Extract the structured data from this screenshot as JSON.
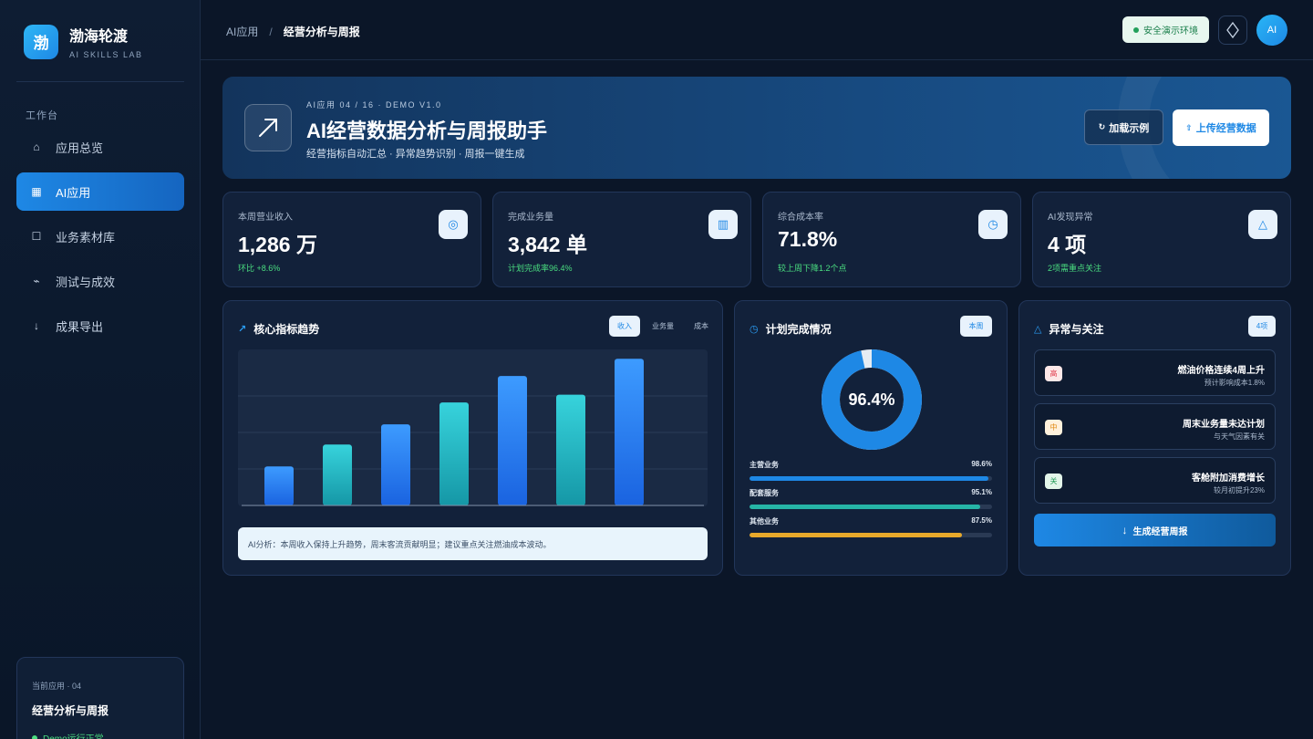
{
  "brand": {
    "logo_char": "渤",
    "name": "渤海轮渡",
    "subtitle": "AI SKILLS LAB"
  },
  "sidebar": {
    "section_label": "工作台",
    "items": [
      {
        "label": "应用总览",
        "icon": "home-icon",
        "glyph": "⌂",
        "active": false
      },
      {
        "label": "AI应用",
        "icon": "grid-icon",
        "glyph": "▦",
        "active": true
      },
      {
        "label": "业务素材库",
        "icon": "folder-icon",
        "glyph": "☐",
        "active": false
      },
      {
        "label": "测试与成效",
        "icon": "pulse-icon",
        "glyph": "⌁",
        "active": false
      },
      {
        "label": "成果导出",
        "icon": "download-icon",
        "glyph": "↓",
        "active": false
      }
    ],
    "current": {
      "label": "当前应用 · 04",
      "name": "经营分析与周报",
      "status": "Demo运行正常"
    }
  },
  "header": {
    "breadcrumb": [
      "AI应用",
      "经营分析与周报"
    ],
    "breadcrumb_sep": "/",
    "env_badge": "安全演示环境",
    "avatar_initials": "AI"
  },
  "hero": {
    "kicker": "AI应用 04 / 16 · DEMO V1.0",
    "title": "AI经营数据分析与周报助手",
    "subtitle": "经营指标自动汇总 · 异常趋势识别 · 周报一键生成",
    "load_button": "加载示例",
    "upload_button": "上传经营数据"
  },
  "kpis": [
    {
      "label": "本周营业收入",
      "value": "1,286 万",
      "note": "环比 +8.6%",
      "icon": "target-icon",
      "glyph": "◎"
    },
    {
      "label": "完成业务量",
      "value": "3,842 单",
      "note": "计划完成率96.4%",
      "icon": "barcode-icon",
      "glyph": "▥"
    },
    {
      "label": "综合成本率",
      "value": "71.8%",
      "note": "较上周下降1.2个点",
      "icon": "clock-icon",
      "glyph": "◷"
    },
    {
      "label": "AI发现异常",
      "value": "4 项",
      "note": "2项需重点关注",
      "icon": "warning-icon",
      "glyph": "△"
    }
  ],
  "trend": {
    "title": "核心指标趋势",
    "tabs": [
      "收入",
      "业务量",
      "成本"
    ],
    "active_tab": 0,
    "analysis": "AI分析：本周收入保持上升趋势，周末客流贡献明显；建议重点关注燃油成本波动。"
  },
  "chart_data": {
    "type": "bar",
    "values": [
      25,
      39,
      52,
      66,
      83,
      71,
      94
    ],
    "ylim": [
      0,
      100
    ],
    "colors": [
      "#2f7ff0",
      "#22b8c2",
      "#2f7ff0",
      "#22b8c2",
      "#2f7ff0",
      "#22b8c2",
      "#2f7ff0"
    ],
    "grid": true
  },
  "plan": {
    "title": "计划完成情况",
    "badge": "本周",
    "donut_value": 96.4,
    "donut_label": "96.4%",
    "items": [
      {
        "label": "主营业务",
        "value_label": "98.6%",
        "value": 98.6,
        "color": "#1e88e5"
      },
      {
        "label": "配套服务",
        "value_label": "95.1%",
        "value": 95.1,
        "color": "#26b5a6"
      },
      {
        "label": "其他业务",
        "value_label": "87.5%",
        "value": 87.5,
        "color": "#e8a92b"
      }
    ]
  },
  "alerts": {
    "title": "异常与关注",
    "badge": "4项",
    "items": [
      {
        "tag": "高",
        "title": "燃油价格连续4周上升",
        "sub": "预计影响成本1.8%",
        "tag_bg": "#fde8e8",
        "tag_color": "#e0394a"
      },
      {
        "tag": "中",
        "title": "周末业务量未达计划",
        "sub": "与天气因素有关",
        "tag_bg": "#fff1dc",
        "tag_color": "#e08a12"
      },
      {
        "tag": "关",
        "title": "客舱附加消费增长",
        "sub": "较月初提升23%",
        "tag_bg": "#e3f6ea",
        "tag_color": "#1f9a55"
      }
    ],
    "generate_button": "生成经营周报"
  }
}
